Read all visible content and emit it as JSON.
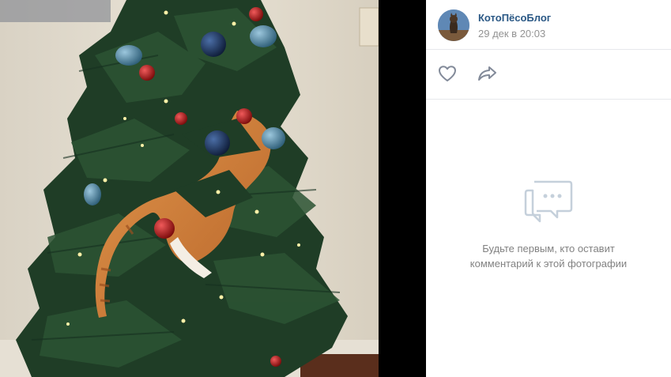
{
  "post": {
    "author_name": "КотоПёсоБлог",
    "date": "29 дек в 20:03"
  },
  "actions": {
    "like_icon": "heart-outline",
    "share_icon": "share-arrow"
  },
  "comments": {
    "empty_icon": "speech-bubble-dots",
    "empty_line1": "Будьте первым, кто оставит",
    "empty_line2": "комментарий к этой фотографии"
  },
  "colors": {
    "link": "#2a5885",
    "muted": "#939393",
    "icon": "#828a99",
    "empty_icon": "#c5d0db"
  }
}
